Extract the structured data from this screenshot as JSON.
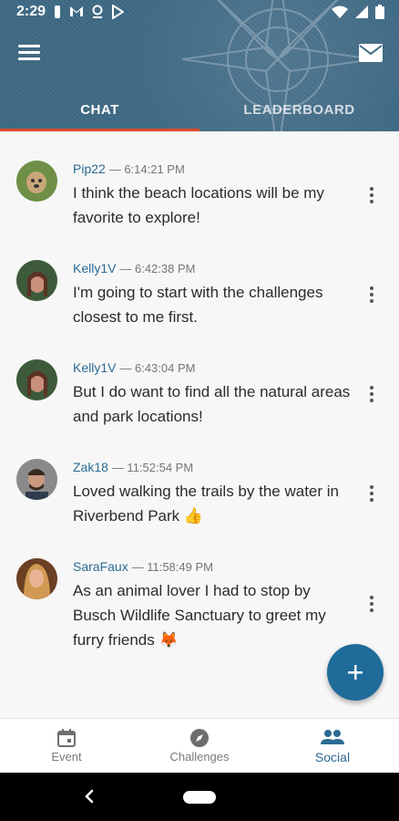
{
  "status": {
    "time": "2:29"
  },
  "tabs": [
    {
      "label": "CHAT",
      "active": true
    },
    {
      "label": "LEADERBOARD",
      "active": false
    }
  ],
  "messages": [
    {
      "user": "Pip22",
      "time": "— 6:14:21 PM",
      "text": "I think the beach locations will be my favorite to explore!",
      "avatar": "dog-avatar"
    },
    {
      "user": "Kelly1V",
      "time": "— 6:42:38 PM",
      "text": "I'm going to start with the challenges closest to me first.",
      "avatar": "kelly-avatar"
    },
    {
      "user": "Kelly1V",
      "time": "— 6:43:04 PM",
      "text": "But I do want to find all the natural areas and park locations!",
      "avatar": "kelly-avatar"
    },
    {
      "user": "Zak18",
      "time": "— 11:52:54 PM",
      "text": "Loved walking the trails by the water in Riverbend Park 👍",
      "avatar": "zak-avatar"
    },
    {
      "user": "SaraFaux",
      "time": "— 11:58:49 PM",
      "text": "As an animal lover I had to stop by Busch Wildlife Sanctuary to greet my furry friends 🦊",
      "avatar": "sara-avatar"
    }
  ],
  "nav": [
    {
      "label": "Event",
      "icon": "calendar-icon",
      "active": false
    },
    {
      "label": "Challenges",
      "icon": "compass-icon",
      "active": false
    },
    {
      "label": "Social",
      "icon": "people-icon",
      "active": true
    }
  ],
  "colors": {
    "header": "#3f6a85",
    "accent": "#e24b2f",
    "link": "#2b6a93",
    "fab": "#1f6b9a"
  }
}
